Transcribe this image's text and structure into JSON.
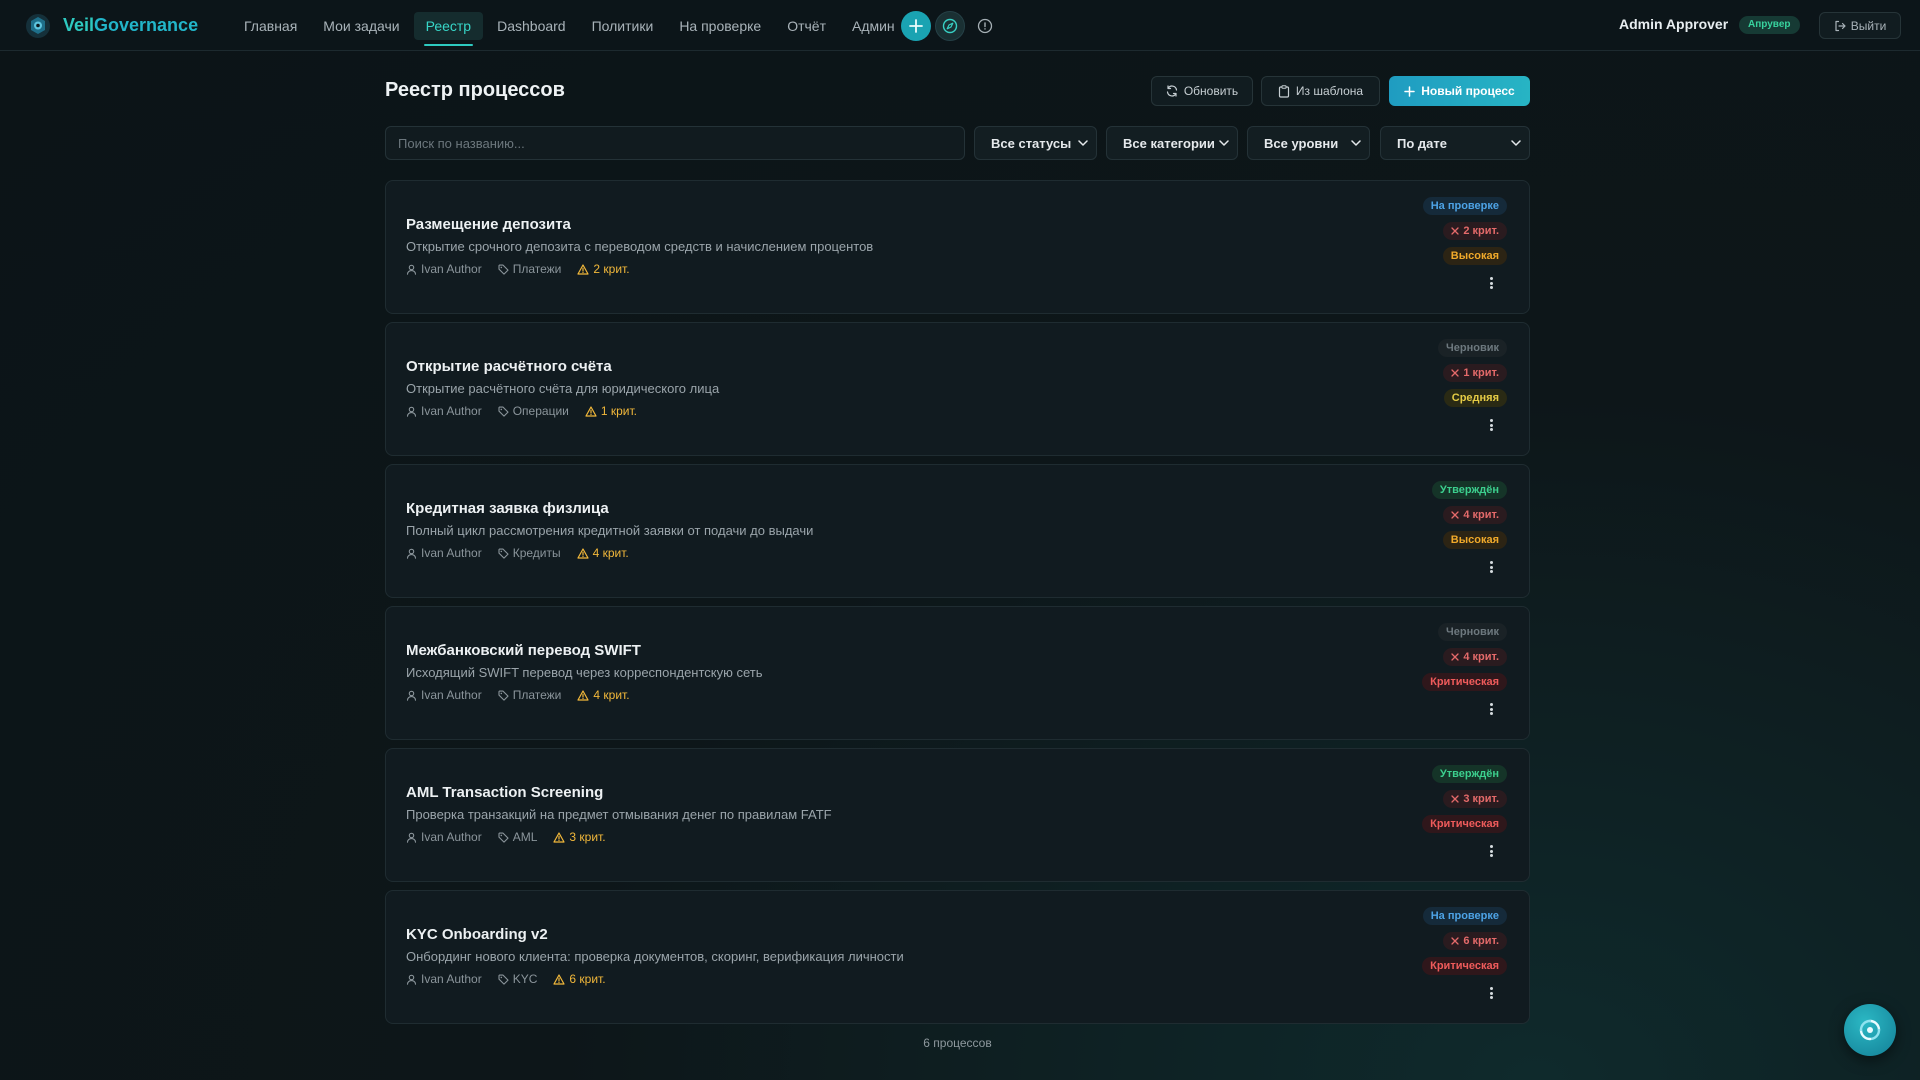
{
  "app": {
    "brand_part1": "Veil",
    "brand_part2": "Governance"
  },
  "nav": [
    {
      "label": "Главная",
      "active": false
    },
    {
      "label": "Мои задачи",
      "active": false
    },
    {
      "label": "Реестр",
      "active": true
    },
    {
      "label": "Dashboard",
      "active": false
    },
    {
      "label": "Политики",
      "active": false
    },
    {
      "label": "На проверке",
      "active": false
    },
    {
      "label": "Отчёт",
      "active": false
    },
    {
      "label": "Админ",
      "active": false
    }
  ],
  "user": {
    "name": "Admin Approver",
    "role": "Апрувер",
    "logout_label": "Выйти"
  },
  "page": {
    "title": "Реестр процессов",
    "refresh_label": "Обновить",
    "template_label": "Из шаблона",
    "new_label": "Новый процесс"
  },
  "filters": {
    "search_placeholder": "Поиск по названию...",
    "status": "Все статусы",
    "category": "Все категории",
    "level": "Все уровни",
    "sort": "По дате"
  },
  "processes": [
    {
      "title": "Размещение депозита",
      "description": "Открытие срочного депозита с переводом средств и начислением процентов",
      "author": "Ivan Author",
      "category": "Платежи",
      "crit_meta": "2 крит.",
      "status": "На проверке",
      "status_kind": "review",
      "crit_badge": "2 крит.",
      "level": "Высокая",
      "level_kind": "high"
    },
    {
      "title": "Открытие расчётного счёта",
      "description": "Открытие расчётного счёта для юридического лица",
      "author": "Ivan Author",
      "category": "Операции",
      "crit_meta": "1 крит.",
      "status": "Черновик",
      "status_kind": "draft",
      "crit_badge": "1 крит.",
      "level": "Средняя",
      "level_kind": "mid"
    },
    {
      "title": "Кредитная заявка физлица",
      "description": "Полный цикл рассмотрения кредитной заявки от подачи до выдачи",
      "author": "Ivan Author",
      "category": "Кредиты",
      "crit_meta": "4 крит.",
      "status": "Утверждён",
      "status_kind": "approved",
      "crit_badge": "4 крит.",
      "level": "Высокая",
      "level_kind": "high"
    },
    {
      "title": "Межбанковский перевод SWIFT",
      "description": "Исходящий SWIFT перевод через корреспондентскую сеть",
      "author": "Ivan Author",
      "category": "Платежи",
      "crit_meta": "4 крит.",
      "status": "Черновик",
      "status_kind": "draft",
      "crit_badge": "4 крит.",
      "level": "Критическая",
      "level_kind": "crit"
    },
    {
      "title": "AML Transaction Screening",
      "description": "Проверка транзакций на предмет отмывания денег по правилам FATF",
      "author": "Ivan Author",
      "category": "AML",
      "crit_meta": "3 крит.",
      "status": "Утверждён",
      "status_kind": "approved",
      "crit_badge": "3 крит.",
      "level": "Критическая",
      "level_kind": "crit"
    },
    {
      "title": "KYC Onboarding v2",
      "description": "Онбординг нового клиента: проверка документов, скоринг, верификация личности",
      "author": "Ivan Author",
      "category": "KYC",
      "crit_meta": "6 крит.",
      "status": "На проверке",
      "status_kind": "review",
      "crit_badge": "6 крит.",
      "level": "Критическая",
      "level_kind": "crit"
    }
  ],
  "footer": {
    "count": "6 процессов"
  }
}
